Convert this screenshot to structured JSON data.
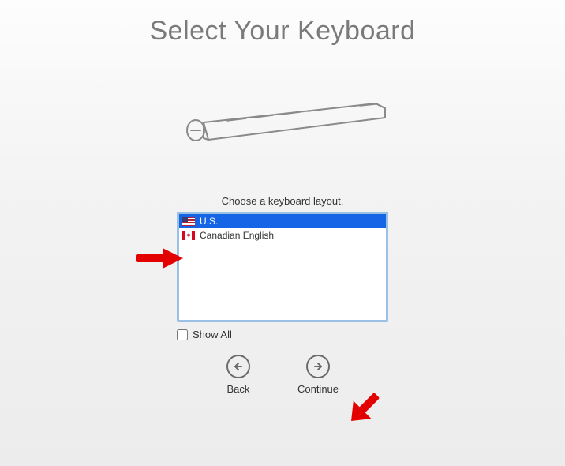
{
  "title": "Select Your Keyboard",
  "prompt": "Choose a keyboard layout.",
  "layouts": [
    {
      "label": "U.S.",
      "flag": "us",
      "selected": true
    },
    {
      "label": "Canadian English",
      "flag": "ca",
      "selected": false
    }
  ],
  "show_all_label": "Show All",
  "show_all_checked": false,
  "nav": {
    "back_label": "Back",
    "continue_label": "Continue"
  }
}
